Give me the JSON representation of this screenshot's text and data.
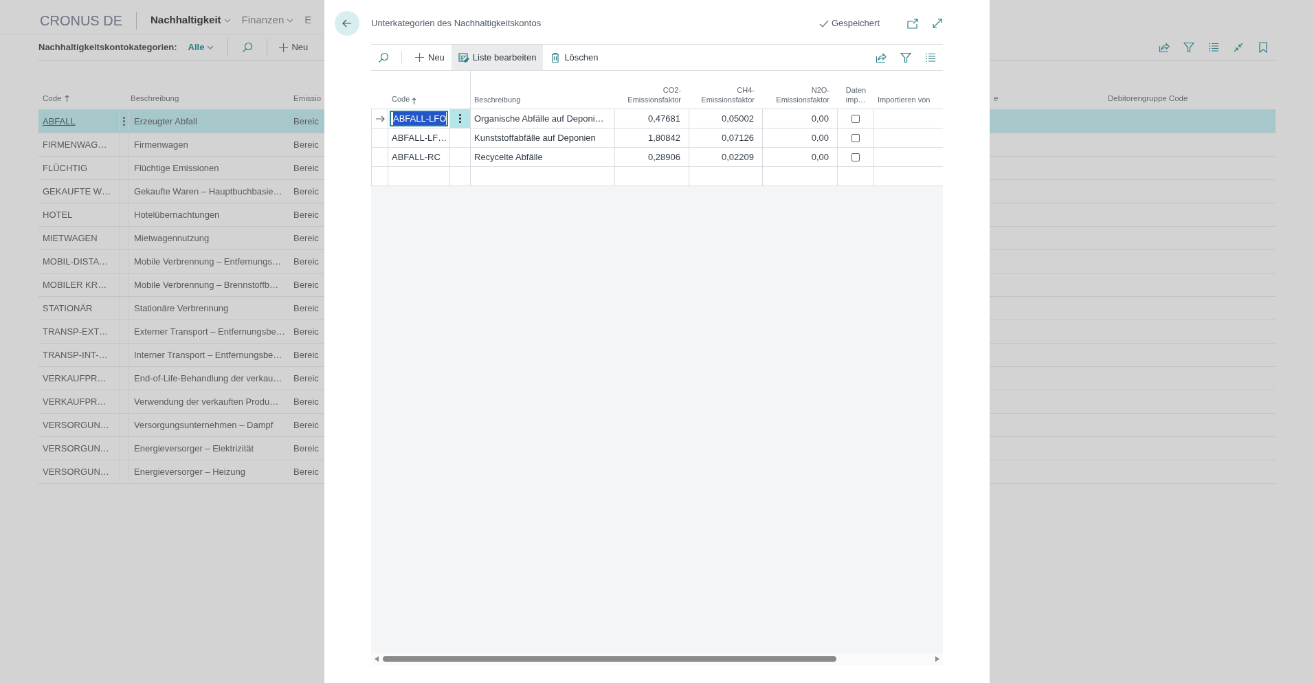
{
  "background_page": {
    "company": "CRONUS DE",
    "nav": [
      {
        "label": "Nachhaltigkeit",
        "selected": true
      },
      {
        "label": "Finanzen",
        "selected": false
      },
      {
        "label": "E",
        "selected": false
      }
    ],
    "list_title": "Nachhaltigkeitskontokategorien:",
    "filter": "Alle",
    "new_action": "Neu",
    "columns": [
      "Code",
      "Beschreibung",
      "Emissio",
      "e",
      "Debitorengruppe Code"
    ],
    "rows": [
      {
        "code": "ABFALL",
        "description": "Erzeugter Abfall",
        "column_3": "Bereic",
        "selected": true
      },
      {
        "code": "FIRMENWAG…",
        "description": "Firmenwagen",
        "column_3": "Bereic",
        "selected": false
      },
      {
        "code": "FLÜCHTIG",
        "description": "Flüchtige Emissionen",
        "column_3": "Bereic",
        "selected": false
      },
      {
        "code": "GEKAUFTE W…",
        "description": "Gekaufte Waren – Hauptbuchbasie…",
        "column_3": "Bereic",
        "selected": false
      },
      {
        "code": "HOTEL",
        "description": "Hotelübernachtungen",
        "column_3": "Bereic",
        "selected": false
      },
      {
        "code": "MIETWAGEN",
        "description": "Mietwagennutzung",
        "column_3": "Bereic",
        "selected": false
      },
      {
        "code": "MOBIL-DISTA…",
        "description": "Mobile Verbrennung – Entfernungs…",
        "column_3": "Bereic",
        "selected": false
      },
      {
        "code": "MOBILER KR…",
        "description": "Mobile Verbrennung – Brennstoffb…",
        "column_3": "Bereic",
        "selected": false
      },
      {
        "code": "STATIONÄR",
        "description": "Stationäre Verbrennung",
        "column_3": "Bereic",
        "selected": false
      },
      {
        "code": "TRANSP-EXT…",
        "description": "Externer Transport – Entfernungsbe…",
        "column_3": "Bereic",
        "selected": false
      },
      {
        "code": "TRANSP-INT-…",
        "description": "Interner Transport – Entfernungsbe…",
        "column_3": "Bereic",
        "selected": false
      },
      {
        "code": "VERKAUFPR…",
        "description": "End-of-Life-Behandlung der verkau…",
        "column_3": "Bereic",
        "selected": false
      },
      {
        "code": "VERKAUFPR…",
        "description": "Verwendung der verkauften Produ…",
        "column_3": "Bereic",
        "selected": false
      },
      {
        "code": "VERSORGUN…",
        "description": "Versorgungsunternehmen – Dampf",
        "column_3": "Bereic",
        "selected": false
      },
      {
        "code": "VERSORGUN…",
        "description": "Energieversorger – Elektrizität",
        "column_3": "Bereic",
        "selected": false
      },
      {
        "code": "VERSORGUN…",
        "description": "Energieversorger – Heizung",
        "column_3": "Bereic",
        "selected": false
      }
    ]
  },
  "dialog": {
    "title": "Unterkategorien des Nachhaltigkeitskontos",
    "status": "Gespeichert",
    "actions": [
      {
        "kind": "new",
        "label": "Neu",
        "selected": false
      },
      {
        "kind": "edit_list",
        "label": "Liste bearbeiten",
        "selected": true
      },
      {
        "kind": "delete",
        "label": "Löschen",
        "selected": false
      }
    ],
    "columns": [
      "Code",
      "Beschreibung",
      "CO2-Emissionsfaktor",
      "CH4-Emissionsfaktor",
      "N2O-Emissionsfaktor",
      "Daten imp…",
      "Importieren von"
    ],
    "rows": [
      {
        "code": "ABFALL-LFO",
        "description": "Organische Abfälle auf Deponi…",
        "co2": "0,47681",
        "ch4": "0,05002",
        "n2o": "0,00",
        "imported": false,
        "selected": true
      },
      {
        "code": "ABFALL-LF…",
        "description": "Kunststoffabfälle auf Deponien",
        "co2": "1,80842",
        "ch4": "0,07126",
        "n2o": "0,00",
        "imported": false,
        "selected": false
      },
      {
        "code": "ABFALL-RC",
        "description": "Recycelte Abfälle",
        "co2": "0,28906",
        "ch4": "0,02209",
        "n2o": "0,00",
        "imported": false,
        "selected": false
      }
    ]
  }
}
